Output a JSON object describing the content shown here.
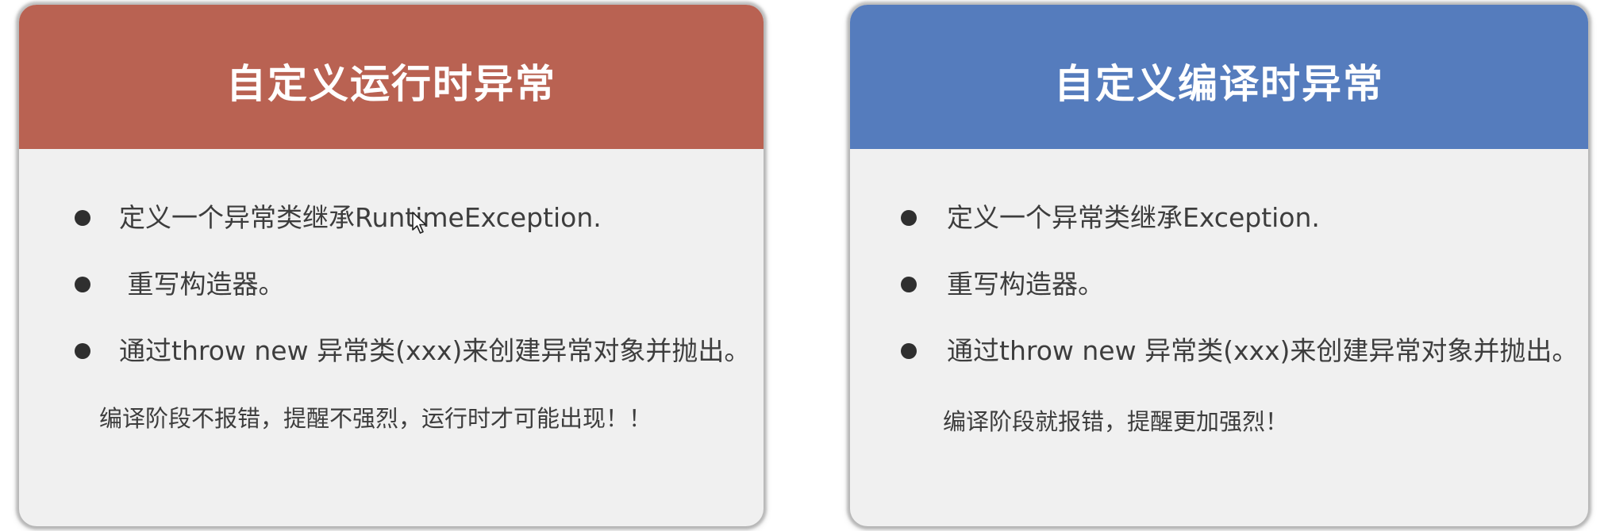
{
  "colors": {
    "left_header": "#b96252",
    "right_header": "#557cbd",
    "card_body": "#f0f0f0",
    "text": "#3d3d3d"
  },
  "left_card": {
    "title": "自定义运行时异常",
    "items": [
      "定义一个异常类继承RuntimeException.",
      " 重写构造器。",
      "通过throw new 异常类(xxx)来创建异常对象并抛出。"
    ],
    "note": "编译阶段不报错，提醒不强烈，运行时才可能出现！！"
  },
  "right_card": {
    "title": "自定义编译时异常",
    "items": [
      "定义一个异常类继承Exception.",
      "重写构造器。",
      "通过throw new 异常类(xxx)来创建异常对象并抛出。"
    ],
    "note": "编译阶段就报错，提醒更加强烈！"
  },
  "icons": {
    "cursor": "mouse-pointer-icon"
  }
}
